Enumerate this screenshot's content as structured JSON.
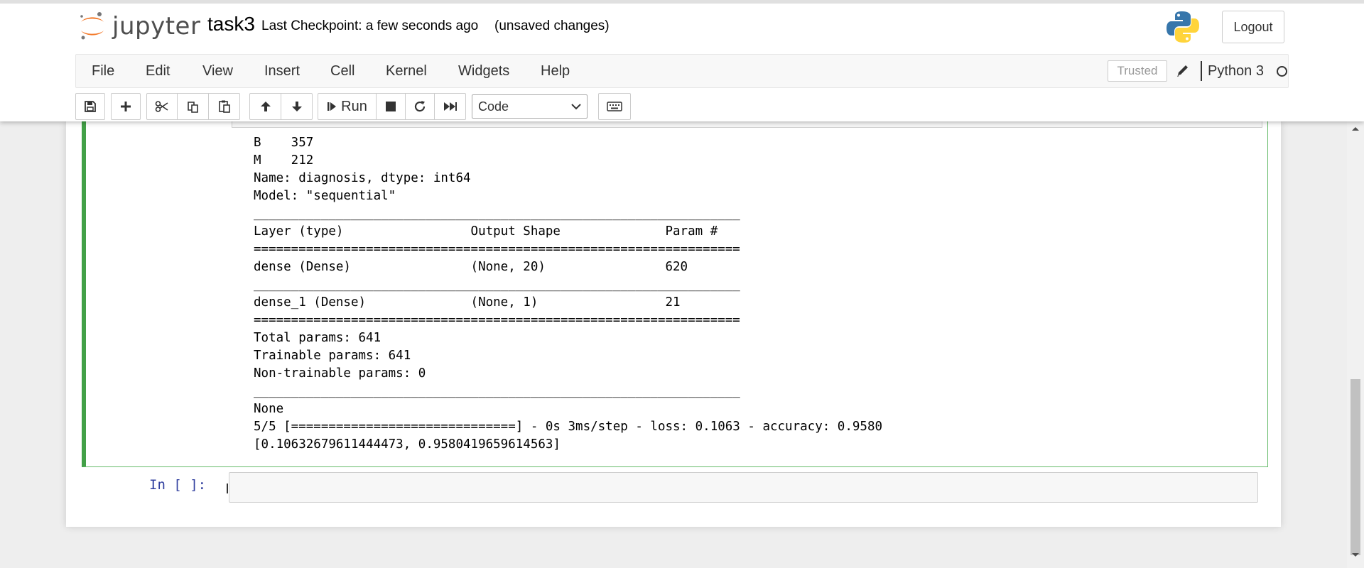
{
  "header": {
    "logo_text": "jupyter",
    "notebook_name": "task3",
    "checkpoint": "Last Checkpoint: a few seconds ago",
    "status": "(unsaved changes)",
    "logout_label": "Logout"
  },
  "menubar": {
    "items": [
      "File",
      "Edit",
      "View",
      "Insert",
      "Cell",
      "Kernel",
      "Widgets",
      "Help"
    ],
    "trusted_label": "Trusted",
    "kernel_name": "Python 3"
  },
  "toolbar": {
    "run_label": "Run",
    "cell_type": "Code"
  },
  "cell_output": {
    "lines": [
      "B    357",
      "M    212",
      "Name: diagnosis, dtype: int64",
      "Model: \"sequential\"",
      "_________________________________________________________________",
      "Layer (type)                 Output Shape              Param #",
      "=================================================================",
      "dense (Dense)                (None, 20)                620",
      "_________________________________________________________________",
      "dense_1 (Dense)              (None, 1)                 21",
      "=================================================================",
      "Total params: 641",
      "Trainable params: 641",
      "Non-trainable params: 0",
      "_________________________________________________________________",
      "None",
      "5/5 [==============================] - 0s 3ms/step - loss: 0.1063 - accuracy: 0.9580",
      "[0.10632679611444473, 0.9580419659614563]"
    ]
  },
  "empty_cell": {
    "prompt": "In [ ]:"
  }
}
